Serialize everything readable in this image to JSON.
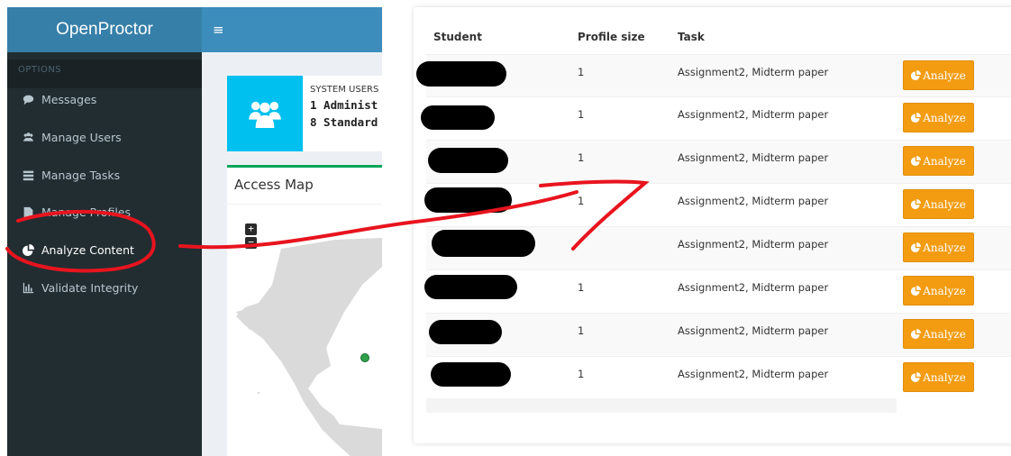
{
  "app": {
    "brand": "OpenProctor",
    "menu_toggle": "≡"
  },
  "sidebar": {
    "section_label": "OPTIONS",
    "items": [
      {
        "label": "Messages",
        "icon": "comment-icon"
      },
      {
        "label": "Manage Users",
        "icon": "users-icon"
      },
      {
        "label": "Manage Tasks",
        "icon": "tasks-icon"
      },
      {
        "label": "Manage Profiles",
        "icon": "file-icon"
      },
      {
        "label": "Analyze Content",
        "icon": "pie-chart-icon"
      },
      {
        "label": "Validate Integrity",
        "icon": "bar-chart-icon"
      }
    ]
  },
  "dashboard": {
    "users_box": {
      "label": "SYSTEM USERS",
      "line1": "1 Administ",
      "line2": "8 Standard",
      "icon": "users-icon",
      "color": "#00c0ef"
    },
    "map": {
      "title": "Access Map",
      "zoom_in": "+",
      "zoom_out": "−"
    }
  },
  "table": {
    "headers": {
      "student": "Student",
      "profile_size": "Profile size",
      "task": "Task"
    },
    "rows": [
      {
        "size": "1",
        "task": "Assignment2, Midterm paper",
        "action": "Analyze"
      },
      {
        "size": "1",
        "task": "Assignment2, Midterm paper",
        "action": "Analyze"
      },
      {
        "size": "1",
        "task": "Assignment2, Midterm paper",
        "action": "Analyze"
      },
      {
        "size": "1",
        "task": "Assignment2, Midterm paper",
        "action": "Analyze"
      },
      {
        "size": "",
        "task": "Assignment2, Midterm paper",
        "action": "Analyze"
      },
      {
        "size": "1",
        "task": "Assignment2, Midterm paper",
        "action": "Analyze"
      },
      {
        "size": "1",
        "task": "Assignment2, Midterm paper",
        "action": "Analyze"
      },
      {
        "size": "1",
        "task": "Assignment2, Midterm paper",
        "action": "Analyze"
      }
    ]
  },
  "colors": {
    "sidebar": "#222d32",
    "brand": "#367fa9",
    "navbar": "#3c8dbc",
    "button": "#f39c12",
    "annotation": "#e8141e"
  }
}
